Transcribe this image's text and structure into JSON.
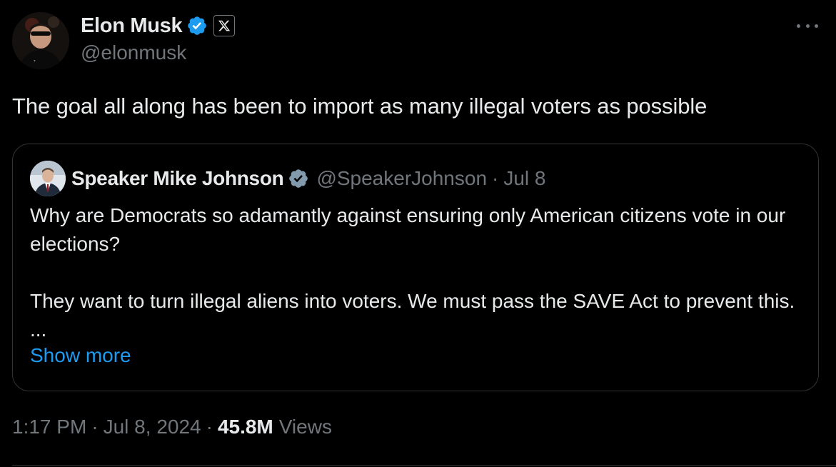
{
  "author": {
    "display_name": "Elon Musk",
    "handle": "@elonmusk",
    "verified": true,
    "affiliation_badge": "X"
  },
  "tweet": {
    "text": "The goal all along has been to import as many illegal voters as possible"
  },
  "quoted_tweet": {
    "display_name": "Speaker Mike Johnson",
    "handle": "@SpeakerJohnson",
    "separator": "·",
    "date": "Jul 8",
    "paragraph_1": "Why are Democrats so adamantly against ensuring only American citizens vote in our elections?",
    "paragraph_2": "They want to turn illegal aliens into voters. We must pass the SAVE Act to prevent this. ...",
    "show_more_label": "Show more"
  },
  "meta": {
    "time": "1:17 PM",
    "separator": "·",
    "date": "Jul 8, 2024",
    "views_count": "45.8M",
    "views_label": "Views"
  },
  "colors": {
    "background": "#000000",
    "primary_text": "#e7e9ea",
    "secondary_text": "#71767b",
    "link": "#1d9bf0",
    "verified_blue": "#1d9bf0",
    "verified_gray": "#829aab",
    "border": "#2f3336"
  },
  "icons": {
    "verified": "verified-badge-icon",
    "affiliation": "x-logo-icon",
    "more": "more-dots-icon"
  }
}
